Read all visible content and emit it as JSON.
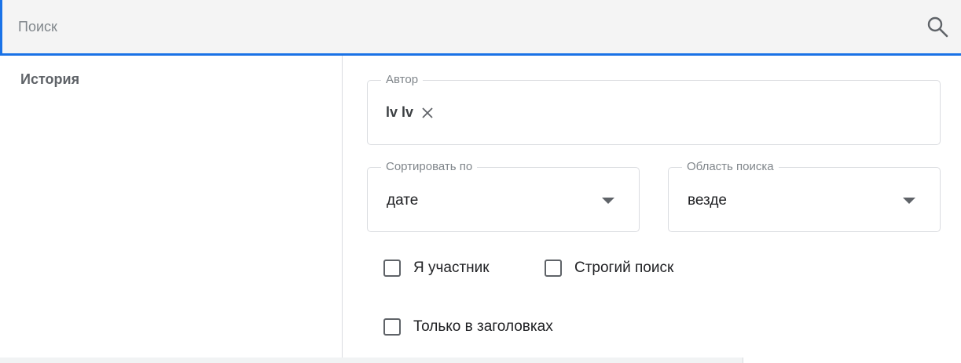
{
  "search": {
    "placeholder": "Поиск",
    "value": "",
    "icon": "search-icon"
  },
  "sidebar": {
    "title": "История"
  },
  "filters": {
    "author": {
      "label": "Автор",
      "chips": [
        {
          "text": "lv lv",
          "remove_icon": "close-icon"
        }
      ]
    },
    "sort_by": {
      "label": "Сортировать по",
      "value": "дате"
    },
    "scope": {
      "label": "Область поиска",
      "value": "везде"
    },
    "checkboxes": [
      {
        "label": "Я участник",
        "checked": false
      },
      {
        "label": "Строгий поиск",
        "checked": false
      },
      {
        "label": "Только в заголовках",
        "checked": false
      }
    ]
  },
  "colors": {
    "accent": "#1a73e8",
    "search_bg": "#f4f4f4",
    "border": "#dadce0",
    "muted_text": "#5f6368"
  }
}
